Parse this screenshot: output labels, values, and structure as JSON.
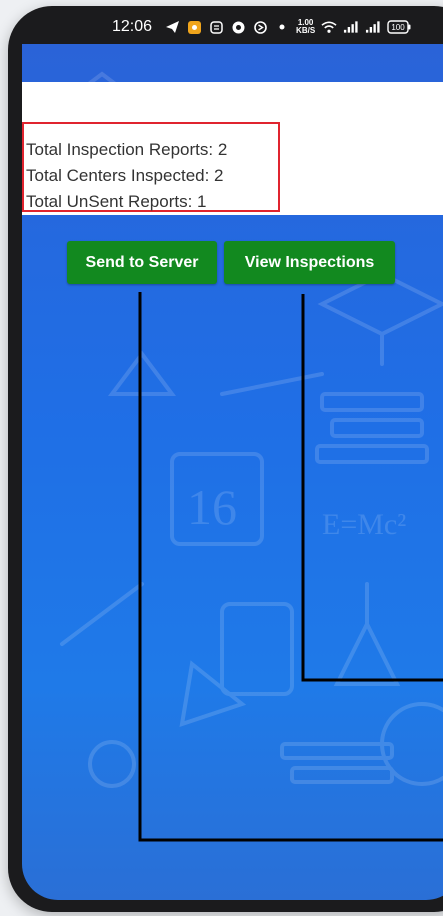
{
  "status_bar": {
    "time": "12:06",
    "speed_value": "1.00",
    "speed_unit": "KB/S",
    "battery": "100"
  },
  "stats": {
    "total_inspection_reports": "Total Inspection Reports: 2",
    "total_centers_inspected": "Total Centers Inspected: 2",
    "total_unsent_reports": "Total UnSent Reports: 1"
  },
  "actions": {
    "send_label": "Send to Server",
    "view_label": "View Inspections"
  },
  "colors": {
    "button_green": "#12891f",
    "highlight_red": "#e0242f",
    "background_blue": "#1f6fe6"
  }
}
